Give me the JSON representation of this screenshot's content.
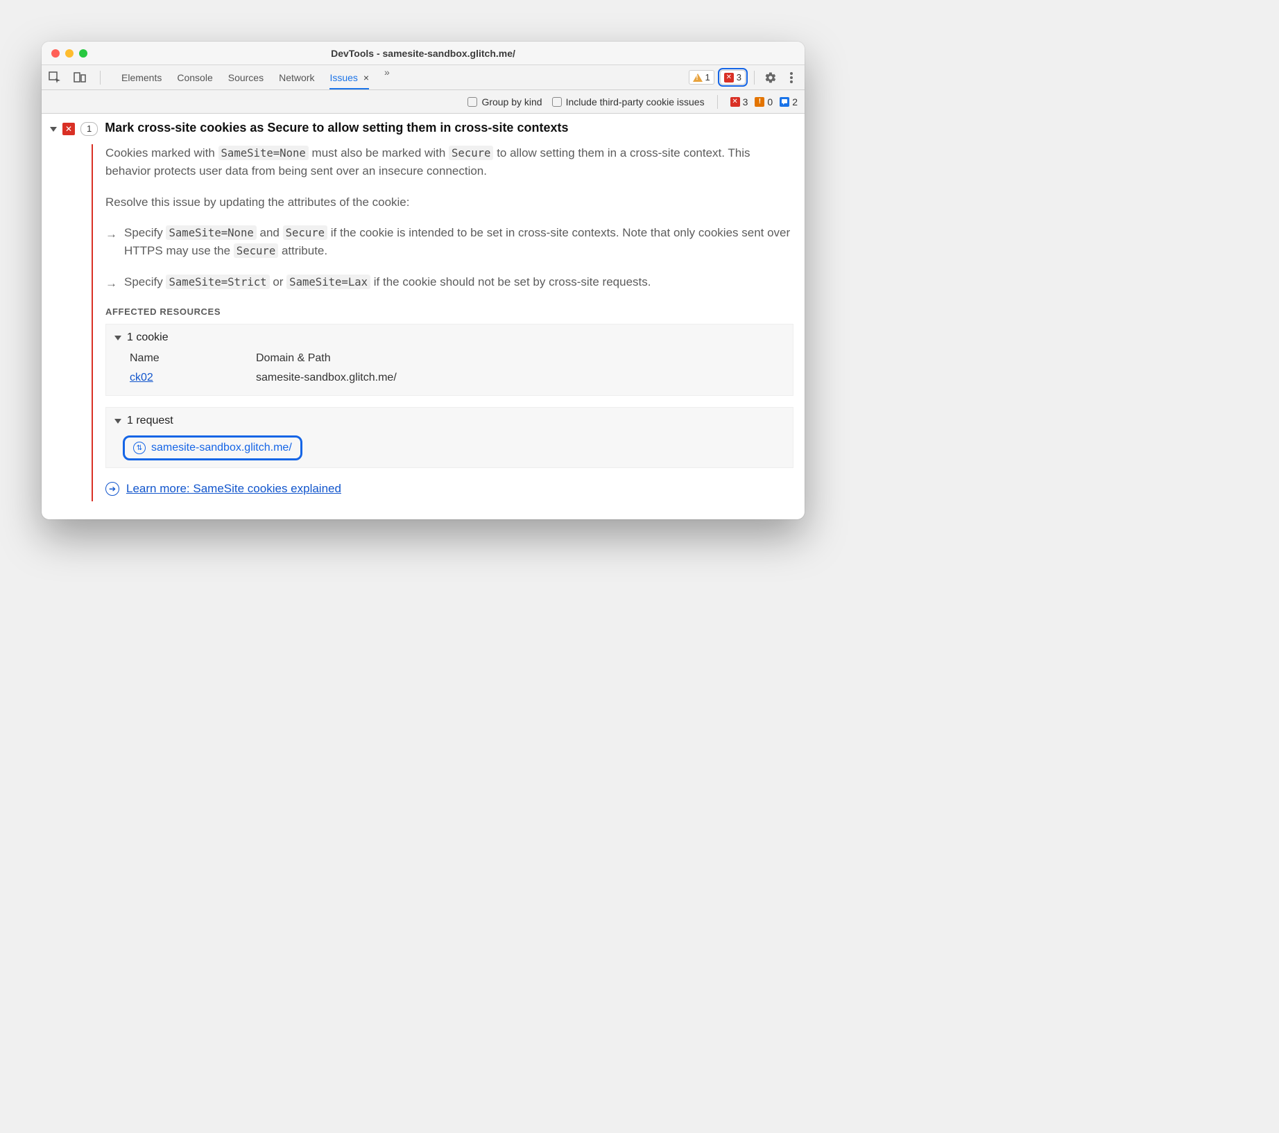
{
  "window": {
    "title": "DevTools - samesite-sandbox.glitch.me/"
  },
  "tabs": {
    "items": [
      "Elements",
      "Console",
      "Sources",
      "Network"
    ],
    "active": "Issues",
    "close_x": "×",
    "more": "»"
  },
  "toolbar_right": {
    "warn_count": "1",
    "err_count": "3"
  },
  "filter": {
    "group_by_kind": "Group by kind",
    "third_party": "Include third-party cookie issues",
    "counts": {
      "err": "3",
      "warn": "0",
      "msg": "2"
    }
  },
  "issue": {
    "count": "1",
    "title": "Mark cross-site cookies as Secure to allow setting them in cross-site contexts",
    "p1a": "Cookies marked with ",
    "p1_code1": "SameSite=None",
    "p1b": " must also be marked with ",
    "p1_code2": "Secure",
    "p1c": " to allow setting them in a cross-site context. This behavior protects user data from being sent over an insecure connection.",
    "p2": "Resolve this issue by updating the attributes of the cookie:",
    "b1a": "Specify ",
    "b1_code1": "SameSite=None",
    "b1b": " and ",
    "b1_code2": "Secure",
    "b1c": " if the cookie is intended to be set in cross-site contexts. Note that only cookies sent over HTTPS may use the ",
    "b1_code3": "Secure",
    "b1d": " attribute.",
    "b2a": "Specify ",
    "b2_code1": "SameSite=Strict",
    "b2b": " or ",
    "b2_code2": "SameSite=Lax",
    "b2c": " if the cookie should not be set by cross-site requests.",
    "affected_heading": "AFFECTED RESOURCES",
    "cookie": {
      "summary": "1 cookie",
      "col_name": "Name",
      "col_domain": "Domain & Path",
      "row_name": "ck02",
      "row_domain": "samesite-sandbox.glitch.me/"
    },
    "request": {
      "summary": "1 request",
      "url": "samesite-sandbox.glitch.me/"
    },
    "learn_more": "Learn more: SameSite cookies explained"
  }
}
